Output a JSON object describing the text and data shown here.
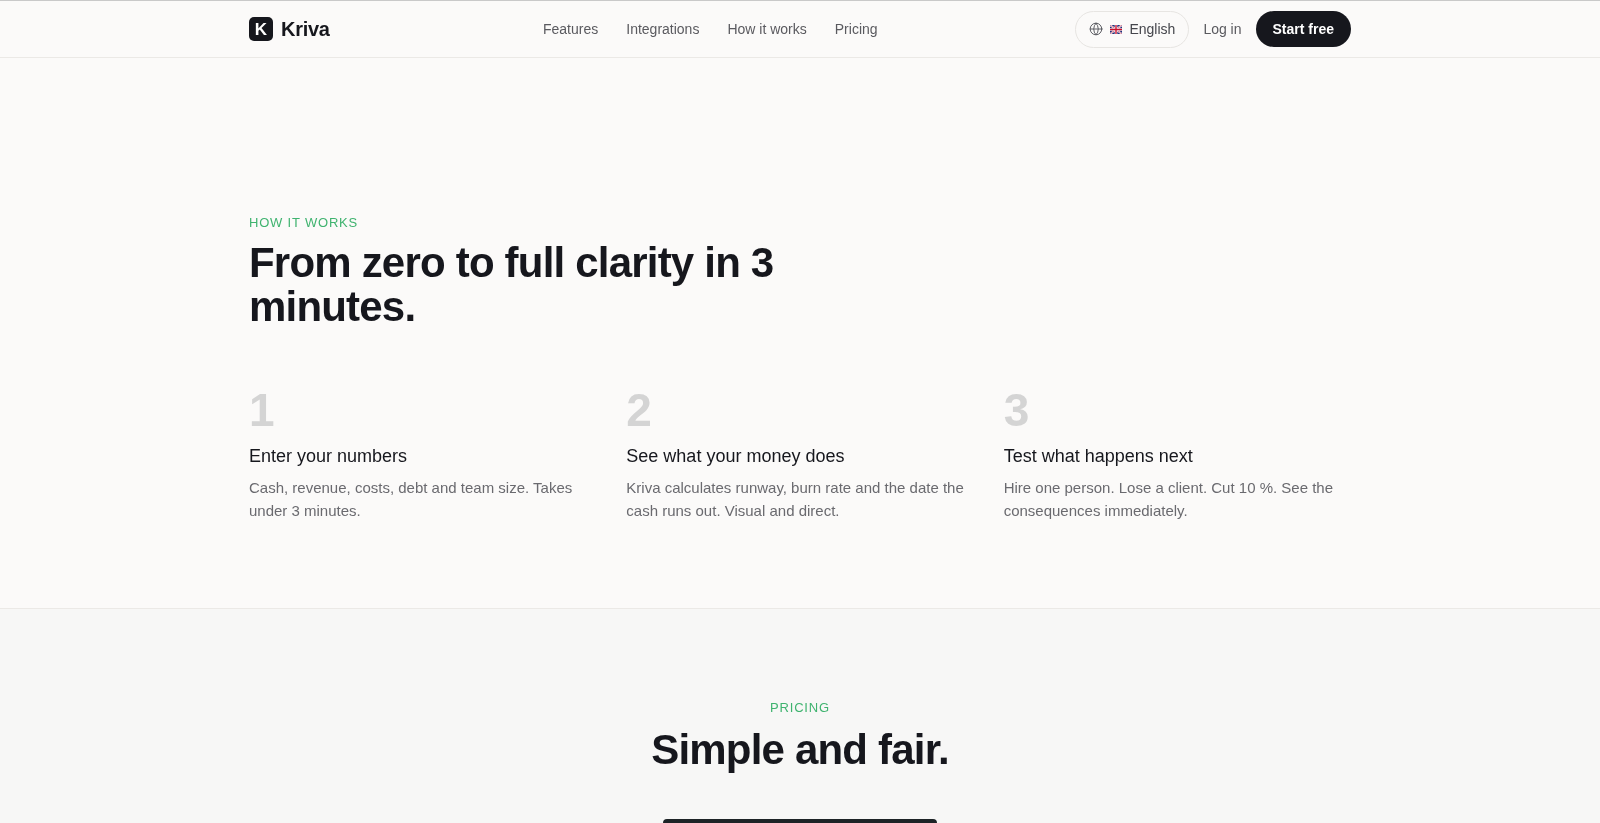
{
  "nav": {
    "logo": {
      "mark": "K",
      "name": "Kriva"
    },
    "links": [
      {
        "label": "Features"
      },
      {
        "label": "Integrations"
      },
      {
        "label": "How it works"
      },
      {
        "label": "Pricing"
      }
    ],
    "language": {
      "label": "English"
    },
    "login": "Log in",
    "cta": "Start free"
  },
  "how_it_works": {
    "eyebrow": "HOW IT WORKS",
    "title": "From zero to full clarity in 3 minutes.",
    "steps": [
      {
        "number": "1",
        "title": "Enter your numbers",
        "description": "Cash, revenue, costs, debt and team size. Takes under 3 minutes."
      },
      {
        "number": "2",
        "title": "See what your money does",
        "description": "Kriva calculates runway, burn rate and the date the cash runs out. Visual and direct."
      },
      {
        "number": "3",
        "title": "Test what happens next",
        "description": "Hire one person. Lose a client. Cut 10 %. See the consequences immediately."
      }
    ]
  },
  "pricing": {
    "eyebrow": "PRICING",
    "title": "Simple and fair."
  }
}
